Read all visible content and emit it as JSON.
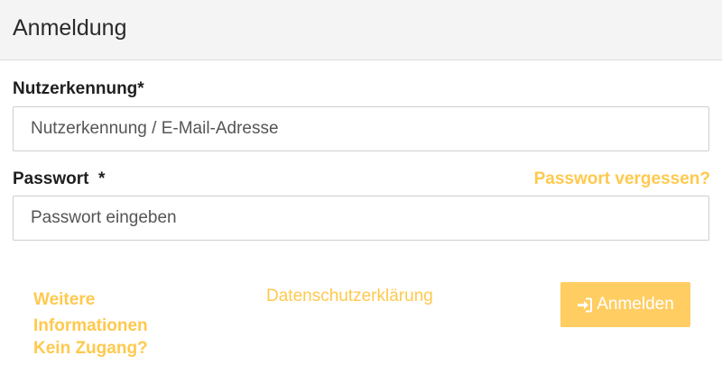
{
  "header": {
    "title": "Anmeldung"
  },
  "form": {
    "username": {
      "label": "Nutzerkennung*",
      "placeholder": "Nutzerkennung / E-Mail-Adresse",
      "value": ""
    },
    "password": {
      "label": "Passwort  *",
      "placeholder": "Passwort eingeben",
      "value": "",
      "forgot_link": "Passwort vergessen?"
    }
  },
  "footer": {
    "more_info": "Weitere Informationen",
    "no_access": "Kein Zugang?",
    "privacy": "Datenschutzerklärung"
  },
  "login_button": {
    "label": "Anmelden",
    "icon": "sign-in-icon"
  },
  "colors": {
    "accent": "#ffc94d",
    "button_bg": "#ffcd62",
    "header_bg": "#f4f4f4"
  }
}
